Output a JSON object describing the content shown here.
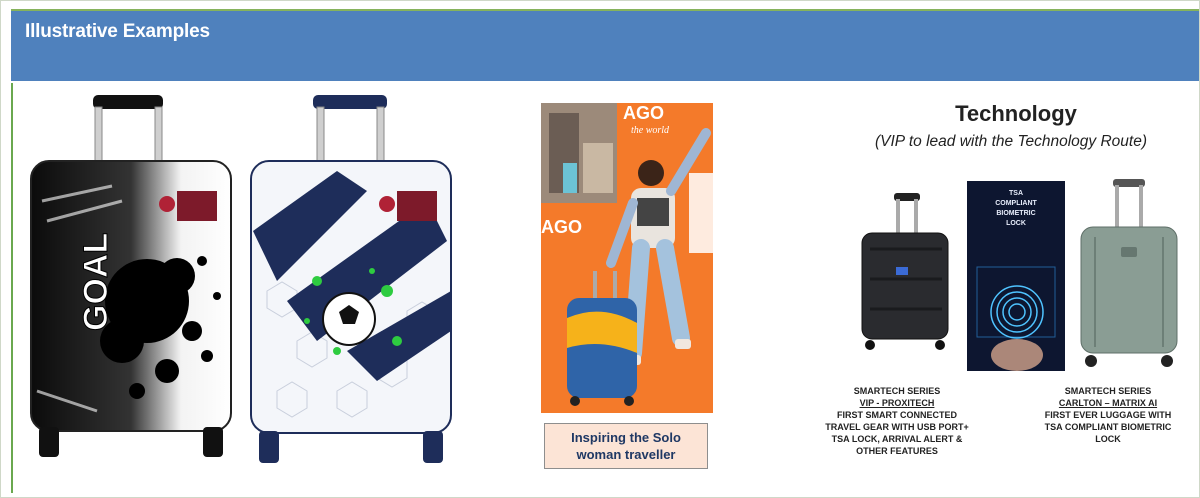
{
  "header": {
    "title": "Illustrative Examples"
  },
  "campaign": {
    "caption_line1": "Inspiring the Solo",
    "caption_line2": "woman traveller",
    "poster_brand": "AGO",
    "poster_tag": "the world",
    "poster_brand2": "AGO"
  },
  "goal_case": {
    "text": "GOAL"
  },
  "technology": {
    "title": "Technology",
    "subtitle": "(VIP to lead with the Technology Route)",
    "lock_panel": [
      "TSA",
      "COMPLIANT",
      "BIOMETRIC",
      "LOCK"
    ],
    "products": [
      {
        "series": "SMARTECH SERIES",
        "name": "VIP - PROXITECH",
        "desc": [
          "FIRST SMART CONNECTED",
          "TRAVEL GEAR WITH USB PORT+",
          "TSA LOCK, ARRIVAL ALERT &",
          "OTHER FEATURES"
        ]
      },
      {
        "series": "SMARTECH SERIES",
        "name": "CARLTON – MATRIX AI",
        "desc": [
          "FIRST EVER LUGGAGE WITH",
          "TSA COMPLIANT BIOMETRIC",
          "LOCK"
        ]
      }
    ]
  },
  "colors": {
    "header": "#4f81bd",
    "header_border": "#86b35c",
    "poster_orange": "#f47a2a",
    "caption_bg": "#fce4d6",
    "navy": "#1e2d5a"
  }
}
